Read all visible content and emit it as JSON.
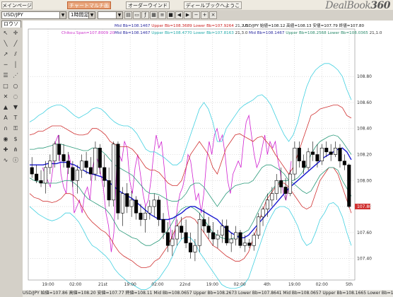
{
  "app": {
    "logo_text": "DealBook",
    "logo_num": "360"
  },
  "tabs": [
    {
      "label": "メインページ",
      "active": false
    },
    {
      "label": "チャートマルチ画面",
      "active": true
    },
    {
      "label": "オーダーウインドー",
      "active": false
    },
    {
      "label": "ディールブックへようこそ",
      "active": false
    }
  ],
  "toolbar": {
    "symbol": "USD/JPY",
    "timeframe": "1時間足",
    "extra_select": "",
    "chart_type": "ロウソク足"
  },
  "chart_data": {
    "type": "candlestick",
    "x_tick_labels": [
      "19:00",
      "02:00",
      "21st",
      "19:00",
      "02:00",
      "22nd",
      "19:00",
      "02:00",
      "4th",
      "19:00",
      "02:00",
      "5th"
    ],
    "ylim": [
      107.3,
      109.1
    ],
    "y_tick_labels": [
      "108.80",
      "108.60",
      "108.40",
      "108.20",
      "108.00",
      "107.80",
      "107.60",
      "107.40"
    ],
    "last_price_label": "107.80",
    "legend_left": {
      "text": "Chikou Span=107.8009 20",
      "color": "#cc33cc"
    },
    "legend_mid1": [
      {
        "text": "Mid Bb=108.1467",
        "color": "#2a2aa0"
      },
      {
        "text": "Upper Bb=108.3689",
        "color": "#cc2222"
      },
      {
        "text": "Lower Bb=107.9264",
        "color": "#cc2222"
      },
      {
        "text": "21,2.0",
        "color": "#333333"
      }
    ],
    "legend_mid2": [
      {
        "text": "Mid Bb=108.1467",
        "color": "#2a2aa0"
      },
      {
        "text": "Upper Bb=108.4770",
        "color": "#22aaaa"
      },
      {
        "text": "Lower Bb=107.8163",
        "color": "#22aaaa"
      },
      {
        "text": "21,3.0",
        "color": "#333333"
      }
    ],
    "legend_mid3": [
      {
        "text": "Mid Bb=108.1467",
        "color": "#2a2aa0"
      },
      {
        "text": "Upper Bb=108.2568",
        "color": "#2a8a6a"
      },
      {
        "text": "Lower Bb=108.0365",
        "color": "#2a8a6a"
      },
      {
        "text": "21,1.0",
        "color": "#333333"
      }
    ],
    "legend_right": "USD/JPY 始値=108.12 高値=108.13 安値=107.79 終値=107.80",
    "series": [
      {
        "name": "Chikou Span",
        "color": "#d020d0",
        "values": [
          108.1,
          108.05,
          108.0,
          107.95,
          108.1,
          108.3,
          108.35,
          108.05,
          107.95,
          107.9,
          108.2,
          108.1,
          107.75,
          107.8,
          107.85,
          107.75,
          107.9,
          107.95,
          107.85,
          108.1,
          108.2,
          108.15,
          108.05,
          107.95,
          107.75,
          107.65,
          107.45,
          107.6,
          108.1,
          108.2,
          108.15,
          108.3,
          108.25,
          108.0,
          107.9,
          108.1,
          108.2,
          108.05,
          107.9,
          107.8,
          107.85,
          108.0,
          108.2,
          108.35,
          108.25,
          108.3,
          108.1,
          107.85,
          107.7,
          107.5,
          107.6,
          107.8,
          107.9,
          107.95,
          108.05,
          108.2,
          108.15,
          108.0,
          107.85,
          107.9,
          107.75,
          107.9,
          108.15,
          108.3,
          108.2,
          108.35,
          108.4,
          108.3,
          108.35,
          108.2,
          108.0,
          107.9,
          108.05,
          108.1,
          108.15,
          108.1,
          108.3,
          108.45,
          108.5,
          108.35,
          108.2,
          108.1,
          108.15,
          108.25,
          108.35,
          108.2,
          108.3,
          108.25,
          108.3,
          108.15,
          108.05,
          107.9,
          107.85,
          107.95,
          108.15
        ]
      },
      {
        "name": "Upper Bb 2σ",
        "color": "#d03030",
        "values": [
          108.35,
          108.36,
          108.38,
          108.38,
          108.4,
          108.42,
          108.42,
          108.42,
          108.4,
          108.38,
          108.36,
          108.35,
          108.35,
          108.36,
          108.4,
          108.4,
          108.38,
          108.35,
          108.3,
          108.28,
          108.26,
          108.26,
          108.26,
          108.24,
          108.2,
          108.15,
          108.1,
          108.08,
          108.08,
          108.06,
          108.02,
          107.98,
          107.96,
          107.96,
          108.0,
          108.1,
          108.2,
          108.25,
          108.3,
          108.25,
          108.2,
          108.1,
          108.05,
          108.15,
          108.25,
          108.3,
          108.35,
          108.36,
          108.34,
          108.32,
          108.3,
          108.33,
          108.34,
          108.3,
          108.26,
          108.2,
          108.15,
          108.1,
          108.05,
          108.1,
          108.2,
          108.3,
          108.4,
          108.5,
          108.52,
          108.55,
          108.56,
          108.57,
          108.58,
          108.58,
          108.56,
          108.5,
          108.48
        ]
      },
      {
        "name": "Lower Bb 2σ",
        "color": "#d03030",
        "values": [
          107.9,
          107.87,
          107.86,
          107.84,
          107.84,
          107.83,
          107.84,
          107.86,
          107.9,
          107.9,
          107.88,
          107.84,
          107.78,
          107.72,
          107.68,
          107.65,
          107.62,
          107.6,
          107.56,
          107.5,
          107.45,
          107.42,
          107.4,
          107.38,
          107.35,
          107.33,
          107.33,
          107.34,
          107.38,
          107.4,
          107.45,
          107.5,
          107.58,
          107.65,
          107.7,
          107.72,
          107.72,
          107.7,
          107.65,
          107.6,
          107.55,
          107.5,
          107.48,
          107.45,
          107.42,
          107.4,
          107.38,
          107.38,
          107.4,
          107.45,
          107.55,
          107.65,
          107.75,
          107.85,
          107.9,
          107.95,
          107.98,
          107.98,
          107.95,
          107.9,
          107.85,
          107.8,
          107.78,
          107.8,
          107.9,
          108.0,
          108.05,
          108.1,
          108.1,
          108.05,
          107.95,
          107.85,
          107.75
        ]
      },
      {
        "name": "Upper Bb 3σ",
        "color": "#40d0e0",
        "values": [
          108.45,
          108.47,
          108.5,
          108.52,
          108.55,
          108.57,
          108.58,
          108.58,
          108.56,
          108.53,
          108.5,
          108.48,
          108.5,
          108.52,
          108.55,
          108.56,
          108.55,
          108.52,
          108.48,
          108.45,
          108.43,
          108.42,
          108.42,
          108.4,
          108.36,
          108.3,
          108.24,
          108.22,
          108.22,
          108.2,
          108.18,
          108.15,
          108.12,
          108.12,
          108.15,
          108.25,
          108.35,
          108.45,
          108.55,
          108.6,
          108.55,
          108.45,
          108.3,
          108.3,
          108.4,
          108.45,
          108.5,
          108.55,
          108.58,
          108.6,
          108.62,
          108.65,
          108.66,
          108.63,
          108.58,
          108.5,
          108.42,
          108.35,
          108.3,
          108.35,
          108.45,
          108.6,
          108.72,
          108.8,
          108.85,
          108.88,
          108.9,
          108.9,
          108.88,
          108.85,
          108.8,
          108.7,
          108.62
        ]
      },
      {
        "name": "Lower Bb 3σ",
        "color": "#40d0e0",
        "values": [
          107.8,
          107.77,
          107.74,
          107.72,
          107.7,
          107.69,
          107.7,
          107.72,
          107.75,
          107.75,
          107.72,
          107.68,
          107.62,
          107.55,
          107.5,
          107.48,
          107.45,
          107.42,
          107.38,
          107.32,
          107.28,
          107.25,
          107.22,
          107.2,
          107.18,
          107.16,
          107.16,
          107.18,
          107.22,
          107.25,
          107.3,
          107.35,
          107.42,
          107.5,
          107.55,
          107.57,
          107.56,
          107.52,
          107.45,
          107.4,
          107.35,
          107.3,
          107.25,
          107.2,
          107.18,
          107.17,
          107.17,
          107.18,
          107.2,
          107.25,
          107.35,
          107.45,
          107.55,
          107.65,
          107.72,
          107.78,
          107.8,
          107.8,
          107.78,
          107.72,
          107.65,
          107.55,
          107.5,
          107.52,
          107.6,
          107.7,
          107.75,
          107.82,
          107.83,
          107.8,
          107.72,
          107.6,
          107.5
        ]
      },
      {
        "name": "Upper Bb 1σ",
        "color": "#2a9a7a",
        "values": [
          108.24,
          108.24,
          108.25,
          108.25,
          108.26,
          108.27,
          108.28,
          108.28,
          108.27,
          108.26,
          108.25,
          108.24,
          108.23,
          108.23,
          108.25,
          108.25,
          108.23,
          108.2,
          108.16,
          108.12,
          108.1,
          108.08,
          108.06,
          108.04,
          108.0,
          107.96,
          107.92,
          107.9,
          107.9,
          107.89,
          107.87,
          107.85,
          107.84,
          107.84,
          107.86,
          107.9,
          107.96,
          107.98,
          107.98,
          107.95,
          107.9,
          107.85,
          107.8,
          107.85,
          107.9,
          107.93,
          107.96,
          107.97,
          107.98,
          107.98,
          108.0,
          108.05,
          108.1,
          108.12,
          108.12,
          108.1,
          108.08,
          108.05,
          108.0,
          108.0,
          108.02,
          108.06,
          108.12,
          108.2,
          108.26,
          108.3,
          108.32,
          108.34,
          108.35,
          108.34,
          108.3,
          108.25,
          108.2
        ]
      },
      {
        "name": "Lower Bb 1σ",
        "color": "#2a9a7a",
        "values": [
          108.02,
          108.0,
          107.99,
          107.98,
          107.98,
          107.98,
          107.98,
          107.99,
          108.0,
          108.0,
          107.98,
          107.95,
          107.9,
          107.86,
          107.84,
          107.82,
          107.8,
          107.78,
          107.74,
          107.68,
          107.62,
          107.6,
          107.58,
          107.56,
          107.55,
          107.52,
          107.5,
          107.5,
          107.52,
          107.54,
          107.58,
          107.62,
          107.68,
          107.74,
          107.78,
          107.8,
          107.8,
          107.78,
          107.75,
          107.7,
          107.65,
          107.6,
          107.58,
          107.56,
          107.55,
          107.55,
          107.56,
          107.58,
          107.6,
          107.62,
          107.68,
          107.75,
          107.82,
          107.88,
          107.92,
          107.96,
          107.99,
          108.0,
          108.0,
          107.98,
          107.95,
          107.92,
          107.9,
          107.92,
          107.98,
          108.04,
          108.07,
          108.1,
          108.1,
          108.08,
          108.0,
          107.94,
          107.88
        ]
      },
      {
        "name": "Mid Bb",
        "color": "#1818d0",
        "values": [
          108.12,
          108.12,
          108.12,
          108.12,
          108.13,
          108.13,
          108.13,
          108.14,
          108.14,
          108.13,
          108.12,
          108.1,
          108.08,
          108.06,
          108.05,
          108.04,
          108.03,
          108.01,
          107.98,
          107.95,
          107.92,
          107.9,
          107.88,
          107.86,
          107.83,
          107.8,
          107.77,
          107.74,
          107.72,
          107.7,
          107.7,
          107.7,
          107.71,
          107.73,
          107.75,
          107.78,
          107.8,
          107.8,
          107.78,
          107.76,
          107.74,
          107.72,
          107.7,
          107.66,
          107.63,
          107.6,
          107.58,
          107.56,
          107.56,
          107.58,
          107.62,
          107.66,
          107.7,
          107.74,
          107.78,
          107.82,
          107.86,
          107.9,
          107.94,
          107.97,
          108.0,
          108.03,
          108.06,
          108.09,
          108.12,
          108.15,
          108.18,
          108.2,
          108.22,
          108.24,
          108.25,
          108.22,
          108.16
        ]
      }
    ],
    "ohlc": [
      [
        108.1,
        108.18,
        108.02,
        108.05
      ],
      [
        108.05,
        108.12,
        107.98,
        108.0
      ],
      [
        108.0,
        108.08,
        107.95,
        107.98
      ],
      [
        107.98,
        108.15,
        107.9,
        108.1
      ],
      [
        108.1,
        108.2,
        108.05,
        108.15
      ],
      [
        108.15,
        108.3,
        108.1,
        108.28
      ],
      [
        108.28,
        108.35,
        108.15,
        108.2
      ],
      [
        108.2,
        108.28,
        108.1,
        108.15
      ],
      [
        108.15,
        108.22,
        108.05,
        108.1
      ],
      [
        108.1,
        108.15,
        107.95,
        108.0
      ],
      [
        108.0,
        108.12,
        107.9,
        108.08
      ],
      [
        108.08,
        108.2,
        108.02,
        108.15
      ],
      [
        108.15,
        108.22,
        108.05,
        108.1
      ],
      [
        108.1,
        108.18,
        108.0,
        108.05
      ],
      [
        108.05,
        108.3,
        108.0,
        108.25
      ],
      [
        108.25,
        108.28,
        108.05,
        108.1
      ],
      [
        108.1,
        108.2,
        107.95,
        108.0
      ],
      [
        108.0,
        108.1,
        107.8,
        107.85
      ],
      [
        107.85,
        108.3,
        107.8,
        108.28
      ],
      [
        108.28,
        108.3,
        107.7,
        107.75
      ],
      [
        107.75,
        107.95,
        107.65,
        107.9
      ],
      [
        107.9,
        107.98,
        107.75,
        107.8
      ],
      [
        107.8,
        107.92,
        107.72,
        107.85
      ],
      [
        107.85,
        107.88,
        107.7,
        107.75
      ],
      [
        107.75,
        107.82,
        107.65,
        107.7
      ],
      [
        107.7,
        107.8,
        107.6,
        107.75
      ],
      [
        107.75,
        107.85,
        107.7,
        107.8
      ],
      [
        107.8,
        107.9,
        107.72,
        107.85
      ],
      [
        107.85,
        107.88,
        107.65,
        107.7
      ],
      [
        107.7,
        107.75,
        107.55,
        107.6
      ],
      [
        107.6,
        107.68,
        107.45,
        107.5
      ],
      [
        107.5,
        107.62,
        107.42,
        107.55
      ],
      [
        107.55,
        107.7,
        107.5,
        107.65
      ],
      [
        107.65,
        107.72,
        107.55,
        107.6
      ],
      [
        107.6,
        107.7,
        107.48,
        107.52
      ],
      [
        107.52,
        107.6,
        107.4,
        107.45
      ],
      [
        107.45,
        107.55,
        107.38,
        107.5
      ],
      [
        107.5,
        107.75,
        107.45,
        107.7
      ],
      [
        107.7,
        107.78,
        107.6,
        107.65
      ],
      [
        107.65,
        107.72,
        107.55,
        107.6
      ],
      [
        107.6,
        107.68,
        107.5,
        107.55
      ],
      [
        107.55,
        107.62,
        107.48,
        107.58
      ],
      [
        107.58,
        107.7,
        107.52,
        107.65
      ],
      [
        107.65,
        107.7,
        107.5,
        107.52
      ],
      [
        107.52,
        107.6,
        107.45,
        107.55
      ],
      [
        107.55,
        107.65,
        107.5,
        107.6
      ],
      [
        107.6,
        107.62,
        107.48,
        107.5
      ],
      [
        107.5,
        107.58,
        107.45,
        107.52
      ],
      [
        107.52,
        107.55,
        107.48,
        107.5
      ],
      [
        107.5,
        107.6,
        107.46,
        107.58
      ],
      [
        107.58,
        107.75,
        107.55,
        107.72
      ],
      [
        107.72,
        107.8,
        107.65,
        107.78
      ],
      [
        107.78,
        107.9,
        107.72,
        107.85
      ],
      [
        107.85,
        107.95,
        107.8,
        107.9
      ],
      [
        107.9,
        108.05,
        107.85,
        108.0
      ],
      [
        108.0,
        108.1,
        107.9,
        107.95
      ],
      [
        107.95,
        108.02,
        107.85,
        107.9
      ],
      [
        107.9,
        108.08,
        107.88,
        108.05
      ],
      [
        108.05,
        108.3,
        108.0,
        108.25
      ],
      [
        108.25,
        108.3,
        108.1,
        108.15
      ],
      [
        108.15,
        108.2,
        108.05,
        108.1
      ],
      [
        108.1,
        108.25,
        108.08,
        108.22
      ],
      [
        108.22,
        108.3,
        108.15,
        108.2
      ],
      [
        108.2,
        108.28,
        108.1,
        108.15
      ],
      [
        108.15,
        108.28,
        108.12,
        108.25
      ],
      [
        108.25,
        108.3,
        108.18,
        108.22
      ],
      [
        108.22,
        108.28,
        108.15,
        108.2
      ],
      [
        108.2,
        108.3,
        108.18,
        108.25
      ],
      [
        108.25,
        108.28,
        108.1,
        108.15
      ],
      [
        108.15,
        108.2,
        108.08,
        108.12
      ],
      [
        108.12,
        108.13,
        107.79,
        107.8
      ]
    ],
    "grid": true,
    "up_color": "#ffffff",
    "down_color": "#000000"
  },
  "status": {
    "text": "USD/JPY 始値=107.86 高値=108.20 安値=107.77 終値=108.11  Mid Bb=108.0657 Upper Bb=108.2673 Lower Bb=107.8641 Mid Bb=108.0657 Upper Bb=108.1665 Lower Bb=107.9649"
  }
}
